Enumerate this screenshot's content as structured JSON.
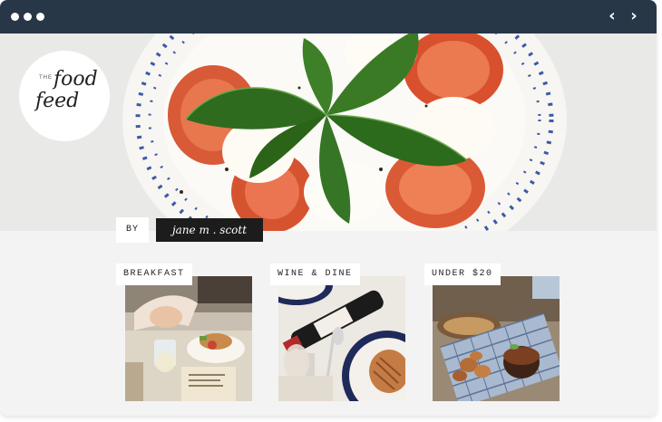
{
  "window": {
    "nav": {
      "back_icon": "‹",
      "forward_icon": "›"
    }
  },
  "brand": {
    "logo_the": "THE",
    "logo_food": "food",
    "logo_feed": "feed"
  },
  "byline": {
    "by_label": "BY",
    "author": "jane m . scott"
  },
  "categories": [
    {
      "label": "BREAKFAST"
    },
    {
      "label": "WINE & DINE"
    },
    {
      "label": "UNDER $20"
    }
  ],
  "colors": {
    "titlebar": "#283748",
    "content_bg": "#f3f3f3",
    "author_bg": "#1c1c1c"
  }
}
